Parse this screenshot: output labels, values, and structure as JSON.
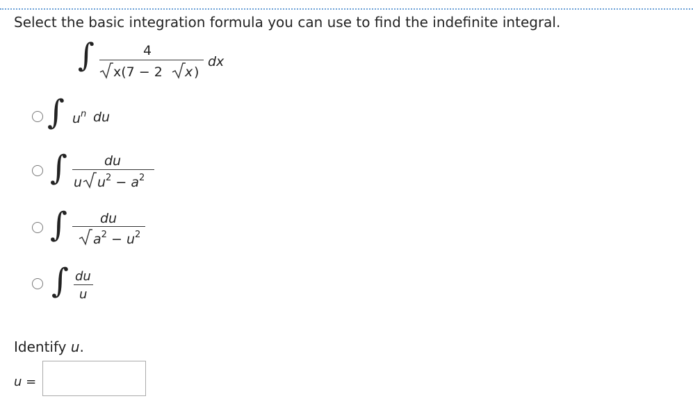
{
  "question": {
    "prompt": "Select the basic integration formula you can use to find the indefinite integral.",
    "integral": {
      "numerator": "4",
      "denominator_a": "x(7 − 2",
      "denominator_b": "x",
      "denominator_c": ")",
      "differential": "dx"
    }
  },
  "options": [
    {
      "id": "a",
      "base": "u",
      "exp": "n",
      "diff": "du"
    },
    {
      "id": "b",
      "numerator": "du",
      "prefix": "u",
      "radicand_a": "u",
      "exp_a": "2",
      "minus": "−",
      "radicand_b": "a",
      "exp_b": "2"
    },
    {
      "id": "c",
      "numerator": "du",
      "radicand_a": "a",
      "exp_a": "2",
      "minus": "−",
      "radicand_b": "u",
      "exp_b": "2"
    },
    {
      "id": "d",
      "numerator": "du",
      "denominator": "u"
    }
  ],
  "identify": {
    "label_prefix": "Identify ",
    "label_var": "u",
    "label_suffix": ".",
    "input_label_var": "u",
    "input_label_eq": "=",
    "input_value": ""
  }
}
